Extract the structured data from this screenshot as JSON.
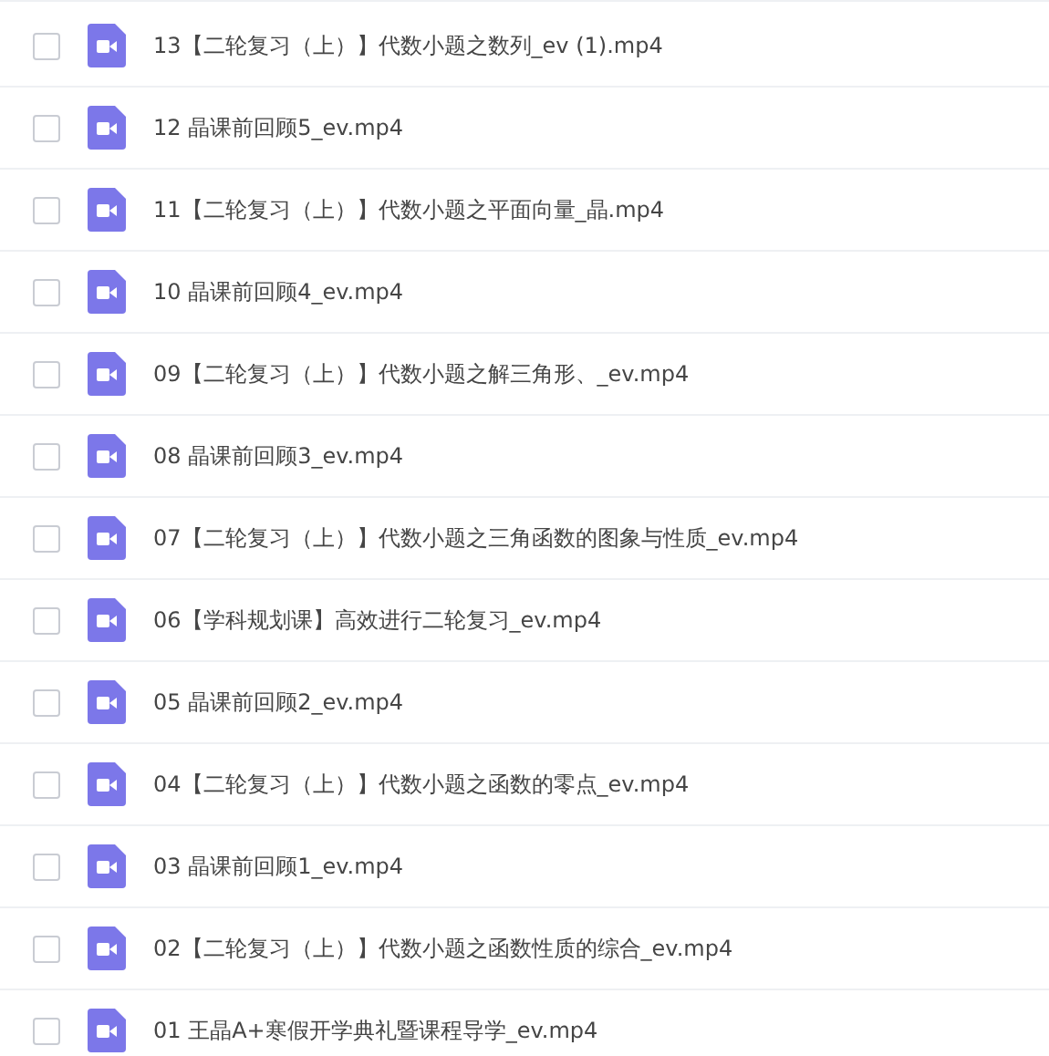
{
  "files": [
    {
      "name": "13【二轮复习（上）】代数小题之数列_ev (1).mp4",
      "checked": false
    },
    {
      "name": "12 晶课前回顾5_ev.mp4",
      "checked": false
    },
    {
      "name": "11【二轮复习（上）】代数小题之平面向量_晶.mp4",
      "checked": false
    },
    {
      "name": "10 晶课前回顾4_ev.mp4",
      "checked": false
    },
    {
      "name": "09【二轮复习（上）】代数小题之解三角形、_ev.mp4",
      "checked": false
    },
    {
      "name": "08 晶课前回顾3_ev.mp4",
      "checked": false
    },
    {
      "name": "07【二轮复习（上）】代数小题之三角函数的图象与性质_ev.mp4",
      "checked": false
    },
    {
      "name": "06【学科规划课】高效进行二轮复习_ev.mp4",
      "checked": false
    },
    {
      "name": "05 晶课前回顾2_ev.mp4",
      "checked": false
    },
    {
      "name": "04【二轮复习（上）】代数小题之函数的零点_ev.mp4",
      "checked": false
    },
    {
      "name": "03 晶课前回顾1_ev.mp4",
      "checked": false
    },
    {
      "name": "02【二轮复习（上）】代数小题之函数性质的综合_ev.mp4",
      "checked": false
    },
    {
      "name": "01 王晶A+寒假开学典礼暨课程导学_ev.mp4",
      "checked": false
    }
  ]
}
